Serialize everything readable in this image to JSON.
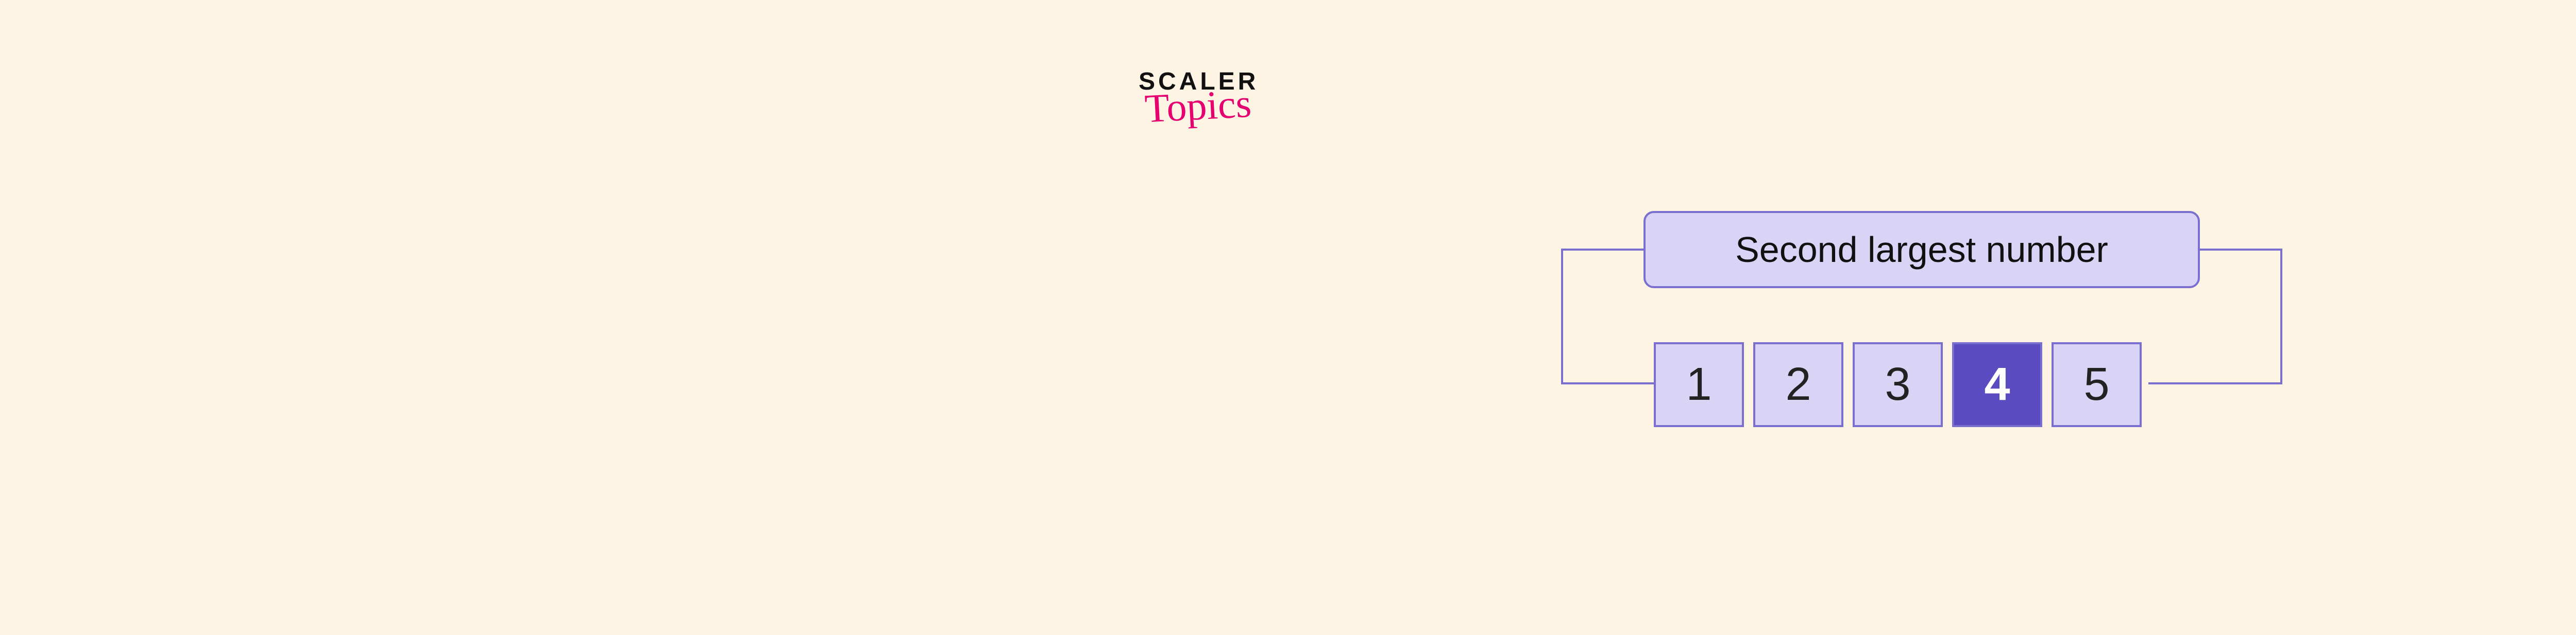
{
  "logo": {
    "line1": "SCALER",
    "line2": "Topics"
  },
  "diagram": {
    "title": "Second largest number",
    "cells": [
      {
        "value": "1",
        "highlight": false
      },
      {
        "value": "2",
        "highlight": false
      },
      {
        "value": "3",
        "highlight": false
      },
      {
        "value": "4",
        "highlight": true
      },
      {
        "value": "5",
        "highlight": false
      }
    ]
  },
  "colors": {
    "page_bg": "#fdf4e3",
    "box_fill": "#d9d4f6",
    "box_border": "#7a6fcf",
    "highlight_fill": "#5a4bc0",
    "logo_accent": "#e6006f"
  }
}
